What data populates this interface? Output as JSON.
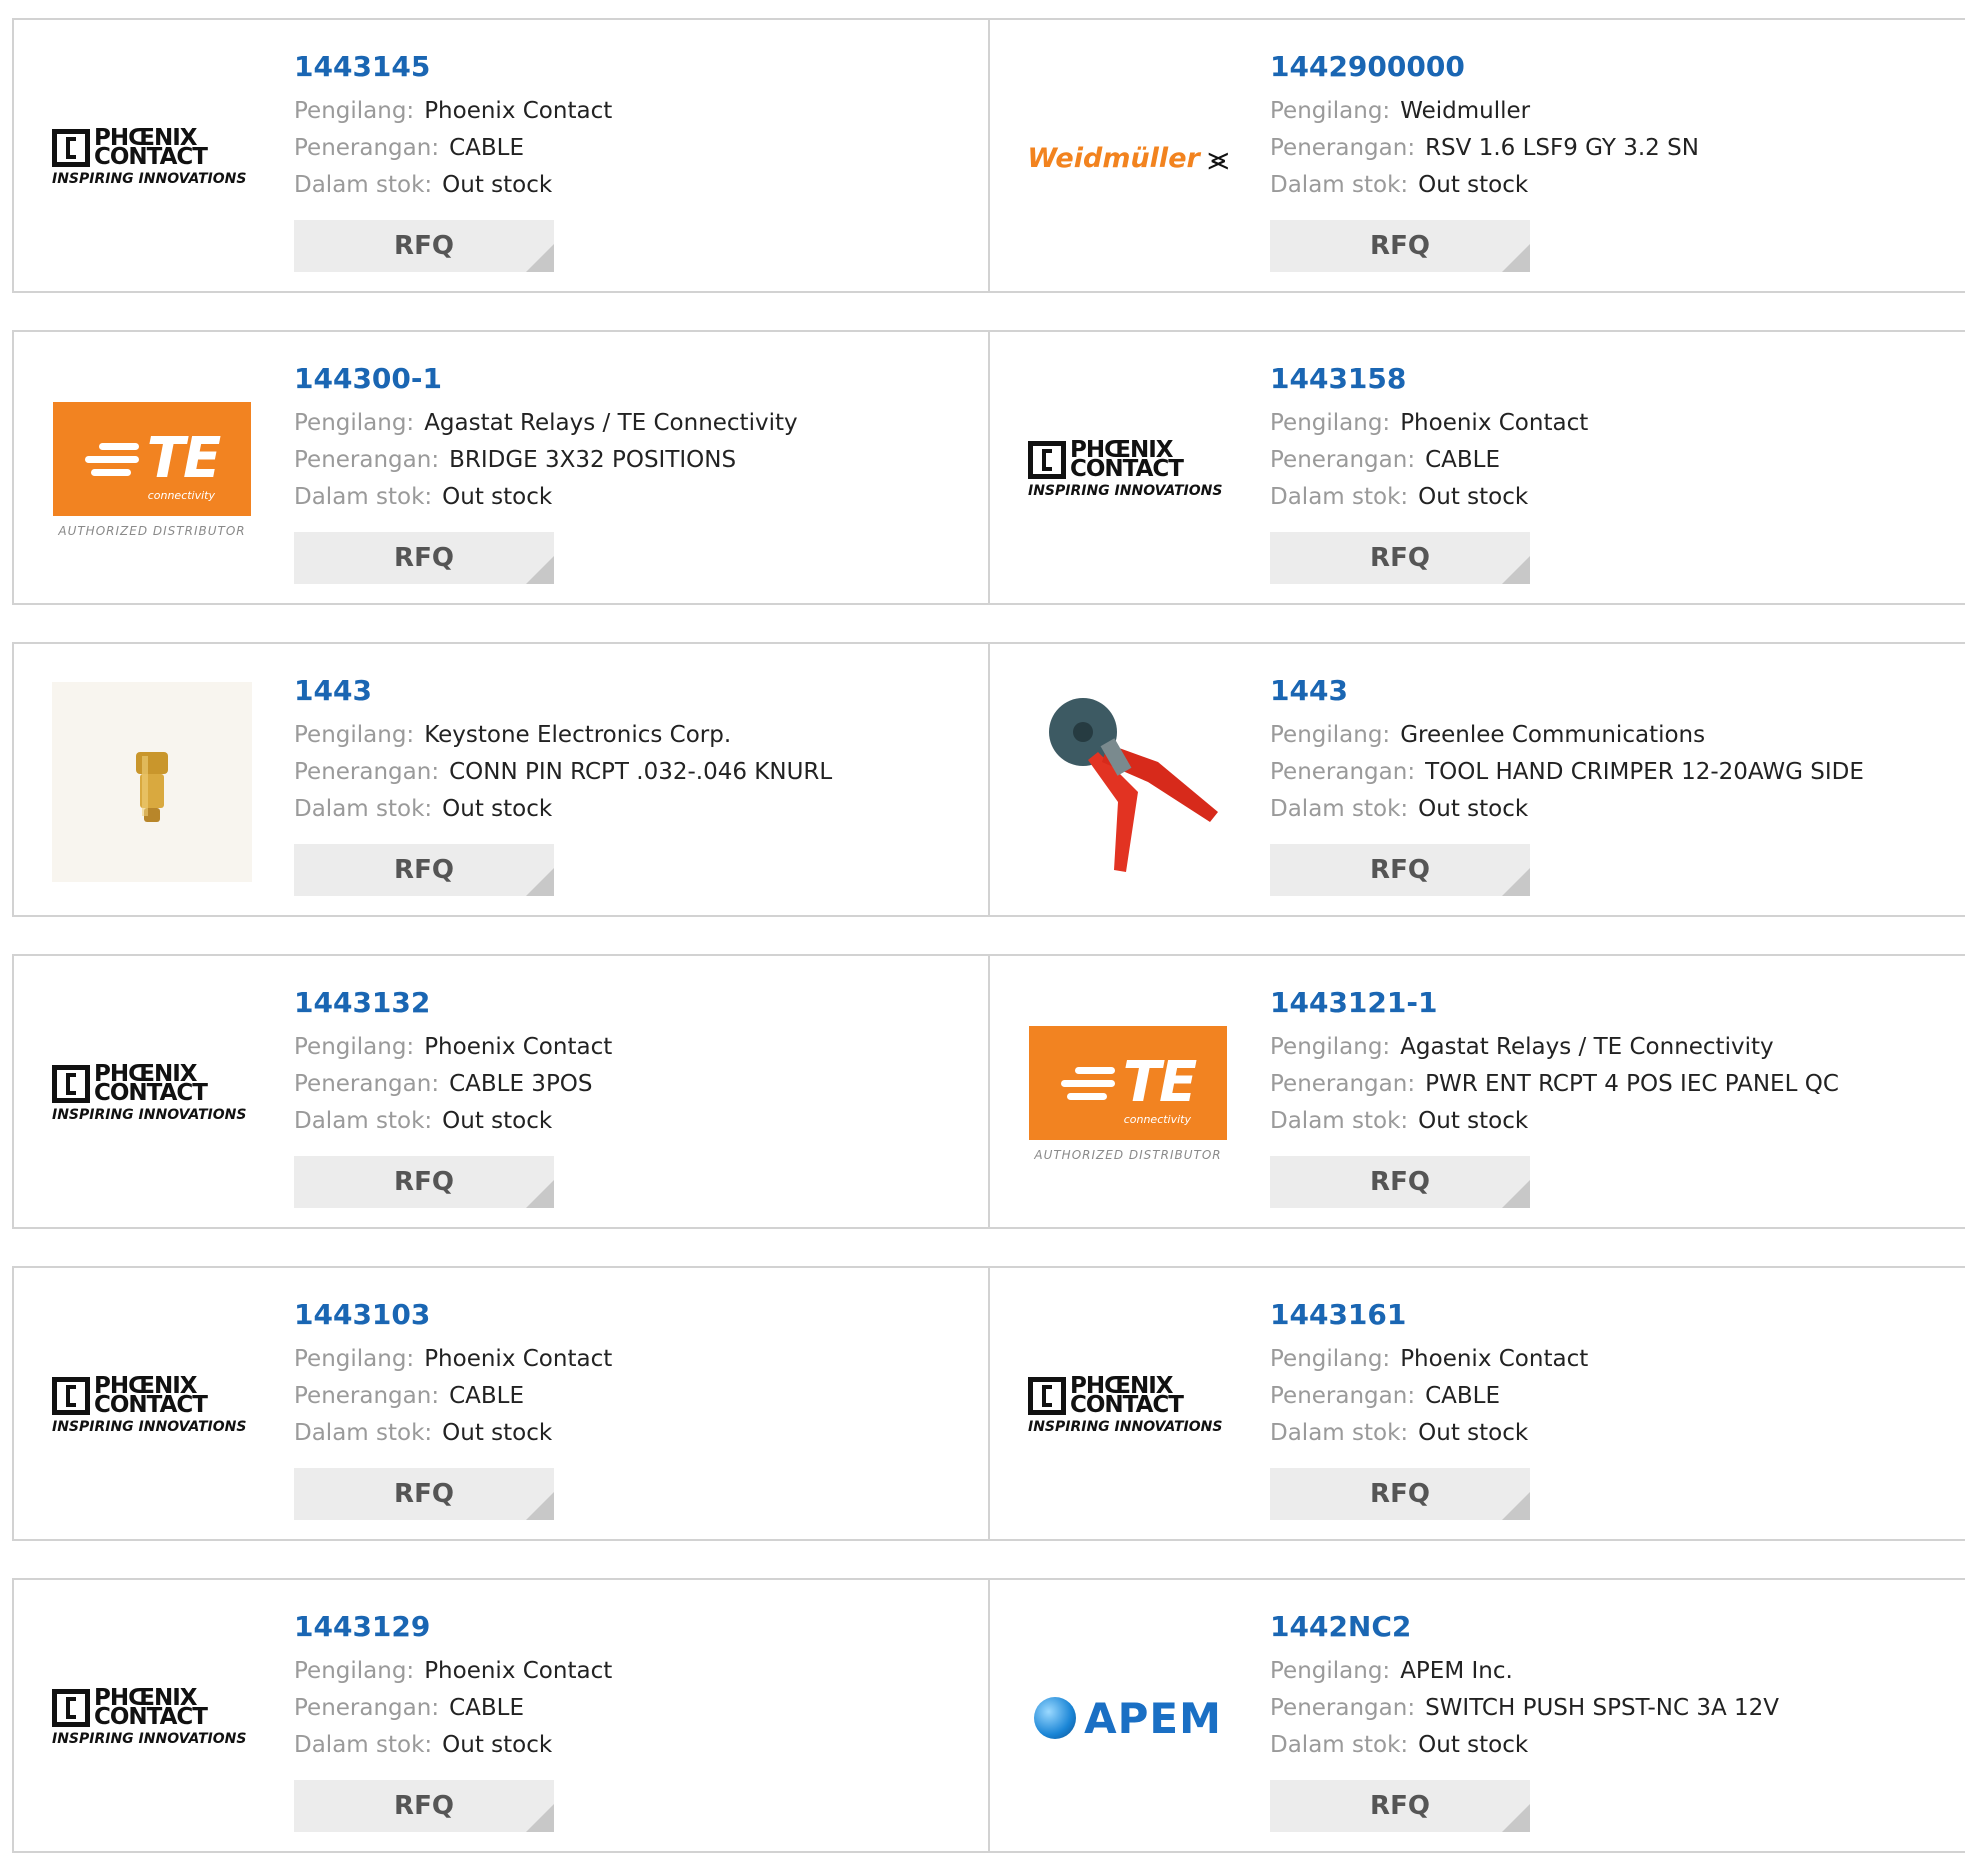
{
  "labels": {
    "manufacturer": "Pengilang:",
    "description": "Penerangan:",
    "stock": "Dalam stok:",
    "rfq": "RFQ"
  },
  "logo_text": {
    "phoenix_line1": "PHŒNIX",
    "phoenix_line2": "CONTACT",
    "phoenix_tagline": "INSPIRING INNOVATIONS",
    "te_mark": "TE",
    "te_sub": "connectivity",
    "te_tagline": "AUTHORIZED DISTRIBUTOR",
    "weidmuller": "Weidmüller",
    "apem": "APEM"
  },
  "products": [
    {
      "part": "1443145",
      "manufacturer": "Phoenix Contact",
      "description": "CABLE",
      "stock": "Out stock",
      "logo": "phoenix-contact-logo"
    },
    {
      "part": "1442900000",
      "manufacturer": "Weidmuller",
      "description": "RSV 1.6 LSF9 GY 3.2 SN",
      "stock": "Out stock",
      "logo": "weidmuller-logo"
    },
    {
      "part": "144300-1",
      "manufacturer": "Agastat Relays / TE Connectivity",
      "description": "BRIDGE 3X32 POSITIONS",
      "stock": "Out stock",
      "logo": "te-connectivity-logo"
    },
    {
      "part": "1443158",
      "manufacturer": "Phoenix Contact",
      "description": "CABLE",
      "stock": "Out stock",
      "logo": "phoenix-contact-logo"
    },
    {
      "part": "1443",
      "manufacturer": "Keystone Electronics Corp.",
      "description": "CONN PIN RCPT .032-.046 KNURL",
      "stock": "Out stock",
      "logo": "brass-pin-photo"
    },
    {
      "part": "1443",
      "manufacturer": "Greenlee Communications",
      "description": "TOOL HAND CRIMPER 12-20AWG SIDE",
      "stock": "Out stock",
      "logo": "crimper-tool-photo"
    },
    {
      "part": "1443132",
      "manufacturer": "Phoenix Contact",
      "description": "CABLE 3POS",
      "stock": "Out stock",
      "logo": "phoenix-contact-logo"
    },
    {
      "part": "1443121-1",
      "manufacturer": "Agastat Relays / TE Connectivity",
      "description": "PWR ENT RCPT 4 POS IEC PANEL QC",
      "stock": "Out stock",
      "logo": "te-connectivity-logo"
    },
    {
      "part": "1443103",
      "manufacturer": "Phoenix Contact",
      "description": "CABLE",
      "stock": "Out stock",
      "logo": "phoenix-contact-logo"
    },
    {
      "part": "1443161",
      "manufacturer": "Phoenix Contact",
      "description": "CABLE",
      "stock": "Out stock",
      "logo": "phoenix-contact-logo"
    },
    {
      "part": "1443129",
      "manufacturer": "Phoenix Contact",
      "description": "CABLE",
      "stock": "Out stock",
      "logo": "phoenix-contact-logo"
    },
    {
      "part": "1442NC2",
      "manufacturer": "APEM Inc.",
      "description": "SWITCH PUSH SPST-NC 3A 12V",
      "stock": "Out stock",
      "logo": "apem-logo"
    }
  ],
  "colors": {
    "part_link": "#1a66b3",
    "label": "#9a9a9a",
    "border": "#d2d2d2",
    "rfq_bg": "#ececec",
    "te_orange": "#f28321",
    "weidmuller_orange": "#f2831f",
    "apem_blue": "#1a6fc4"
  }
}
